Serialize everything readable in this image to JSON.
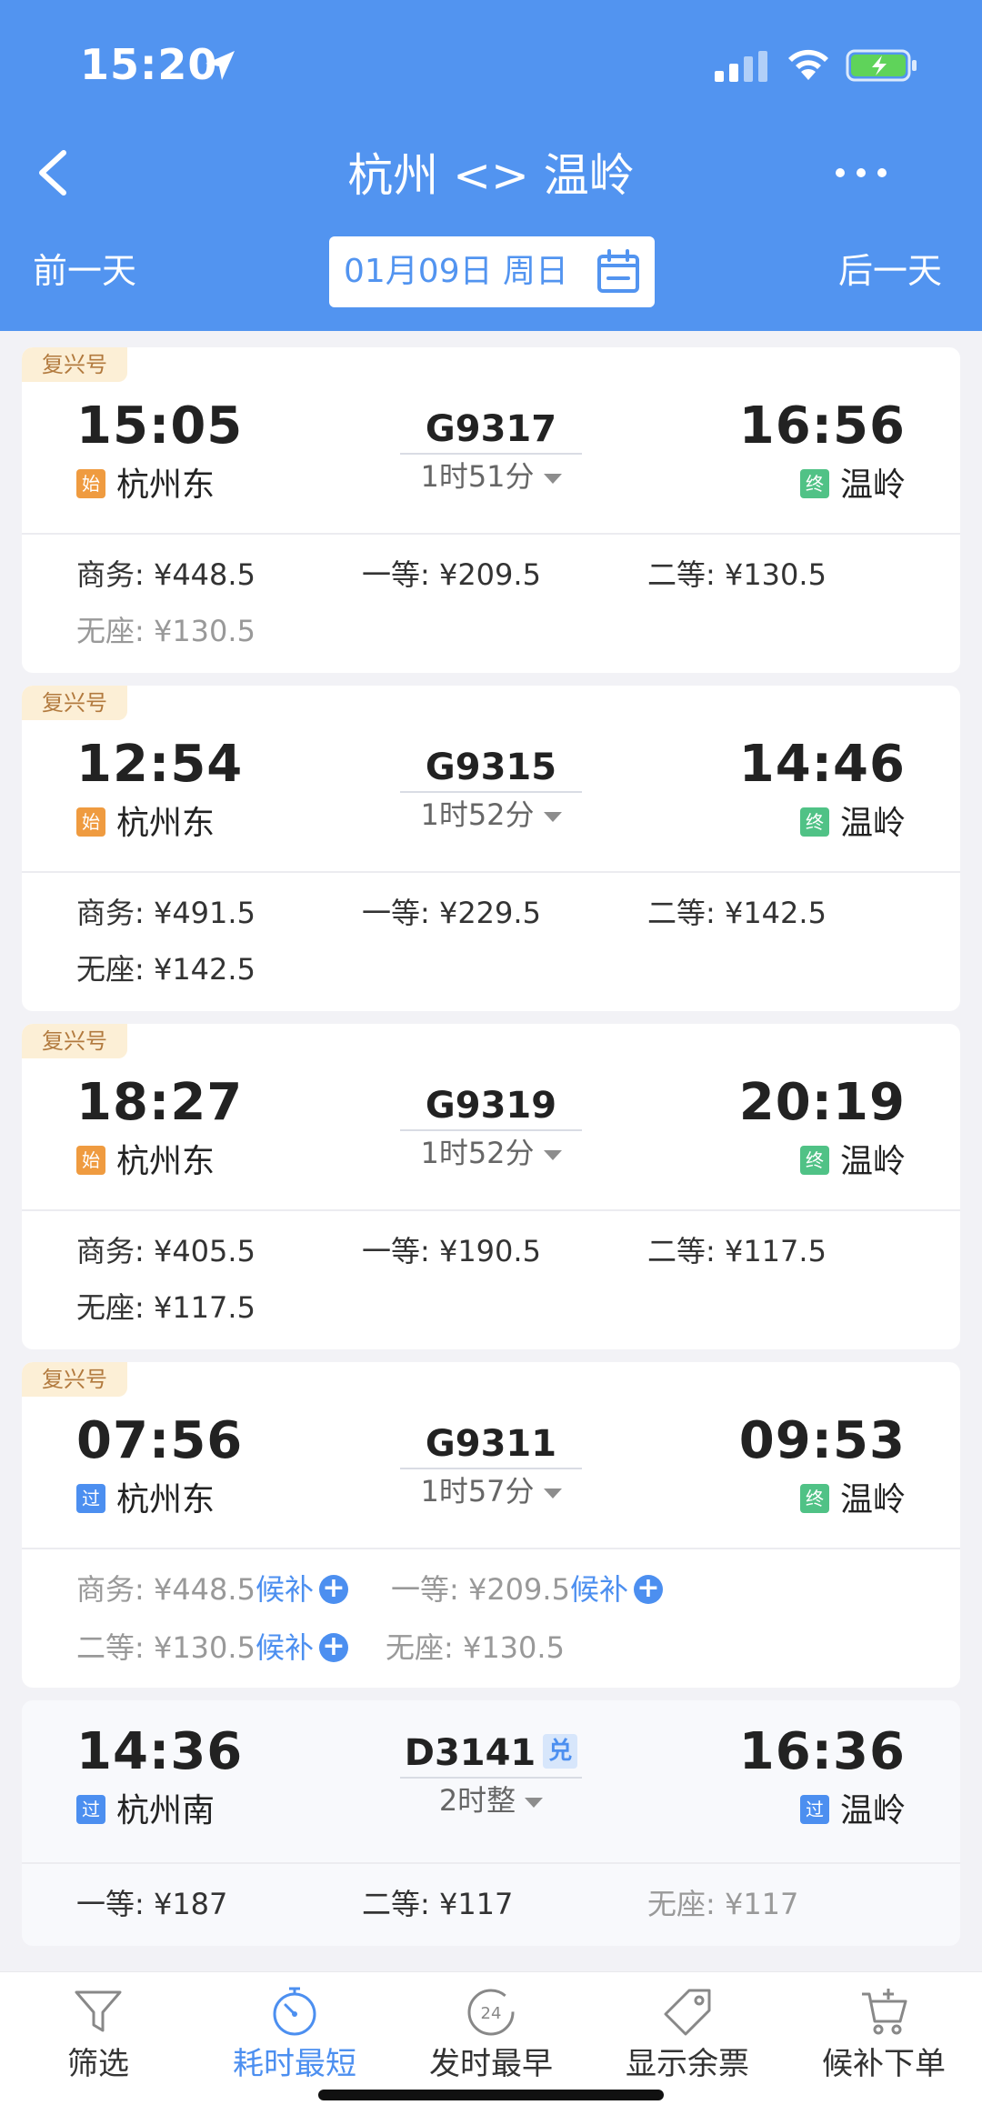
{
  "status": {
    "time": "15:20"
  },
  "header": {
    "title": "杭州 <> 温岭",
    "prev_day": "前一天",
    "next_day": "后一天",
    "date": "01月09日 周日"
  },
  "colors": {
    "header_bg": "#5294f0",
    "accent": "#4c8ff0",
    "tag_bg": "#fcefd6"
  },
  "trains": [
    {
      "tag": "复兴号",
      "dep_time": "15:05",
      "arr_time": "16:56",
      "no": "G9317",
      "duration": "1时51分",
      "dep_badge": "始",
      "dep_station": "杭州东",
      "arr_badge": "终",
      "arr_station": "温岭",
      "prices": [
        "商务: ¥448.5",
        "一等: ¥209.5",
        "二等: ¥130.5"
      ],
      "price_row2": "无座: ¥130.5"
    },
    {
      "tag": "复兴号",
      "dep_time": "12:54",
      "arr_time": "14:46",
      "no": "G9315",
      "duration": "1时52分",
      "dep_badge": "始",
      "dep_station": "杭州东",
      "arr_badge": "终",
      "arr_station": "温岭",
      "prices": [
        "商务: ¥491.5",
        "一等: ¥229.5",
        "二等: ¥142.5"
      ],
      "price_row2": "无座: ¥142.5"
    },
    {
      "tag": "复兴号",
      "dep_time": "18:27",
      "arr_time": "20:19",
      "no": "G9319",
      "duration": "1时52分",
      "dep_badge": "始",
      "dep_station": "杭州东",
      "arr_badge": "终",
      "arr_station": "温岭",
      "prices": [
        "商务: ¥405.5",
        "一等: ¥190.5",
        "二等: ¥117.5"
      ],
      "price_row2": "无座: ¥117.5"
    },
    {
      "tag": "复兴号",
      "dep_time": "07:56",
      "arr_time": "09:53",
      "no": "G9311",
      "duration": "1时57分",
      "dep_badge": "过",
      "dep_station": "杭州东",
      "arr_badge": "终",
      "arr_station": "温岭",
      "prices": [
        "商务: ¥448.5",
        "一等: ¥209.5",
        "二等: ¥130.5",
        "无座: ¥130.5"
      ],
      "waitlist_label": "候补",
      "plus": "+"
    },
    {
      "dep_time": "14:36",
      "arr_time": "16:36",
      "no": "D3141",
      "dui": "兑",
      "duration": "2时整",
      "dep_badge": "过",
      "dep_station": "杭州南",
      "arr_badge": "过",
      "arr_station": "温岭",
      "prices": [
        "一等: ¥187",
        "二等: ¥117",
        "无座: ¥117"
      ]
    }
  ],
  "tabbar": [
    {
      "label": "筛选",
      "icon": "filter-icon"
    },
    {
      "label": "耗时最短",
      "icon": "stopwatch-icon",
      "active": true
    },
    {
      "label": "发时最早",
      "icon": "clock-24-icon",
      "clock_text": "24"
    },
    {
      "label": "显示余票",
      "icon": "ticket-tag-icon"
    },
    {
      "label": "候补下单",
      "icon": "cart-icon"
    }
  ]
}
